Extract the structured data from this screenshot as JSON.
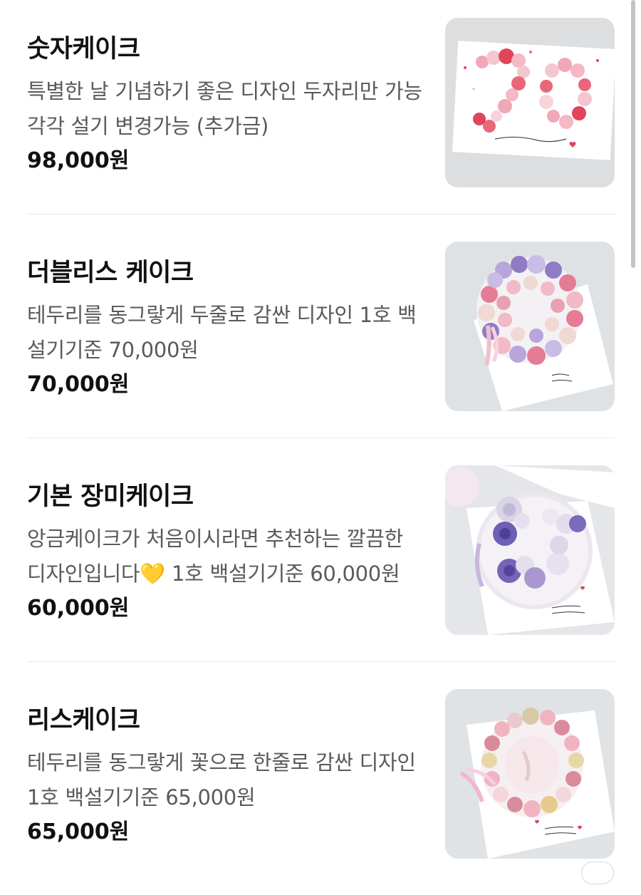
{
  "menu": {
    "items": [
      {
        "name": "숫자케이크",
        "description": "특별한 날 기념하기 좋은 디자인 두자리만 가능 각각 설기 변경가능 (추가금)",
        "price": "98,000원",
        "image_icon": "number-cake-photo",
        "card_text": "항상 고맙습니다 ♥"
      },
      {
        "name": "더블리스 케이크",
        "description": "테두리를 동그랗게 두줄로 감싼 디자인 1호 백설기기준 70,000원",
        "price": "70,000원",
        "image_icon": "double-wreath-cake-photo",
        "card_text": "축하해 ♥"
      },
      {
        "name": "기본 장미케이크",
        "description": "앙금케이크가 처음이시라면 추천하는 깔끔한 디자인입니다💛 1호 백설기기준 60,000원",
        "price": "60,000원",
        "image_icon": "basic-rose-cake-photo",
        "card_text": "생일 축하해 ♥"
      },
      {
        "name": "리스케이크",
        "description": "테두리를 동그랗게 꽃으로 한줄로 감싼 디자인 1호 백설기기준 65,000원",
        "price": "65,000원",
        "image_icon": "wreath-cake-photo",
        "card_text": "사랑해 ♥"
      }
    ]
  },
  "colors": {
    "name_text": "#111111",
    "desc_text": "#5a5a5a",
    "divider": "#e9e9e9",
    "thumb_bg": "#dfe1e3"
  }
}
